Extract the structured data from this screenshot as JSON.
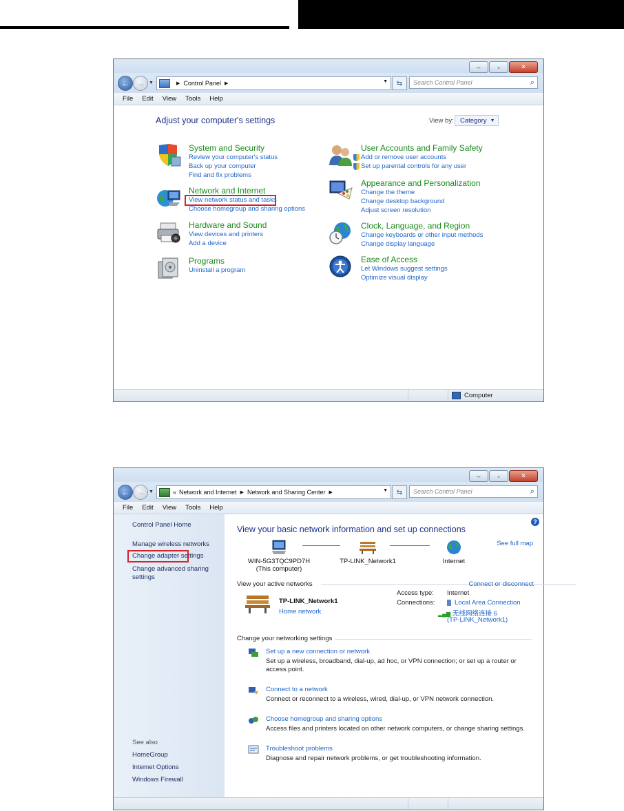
{
  "window1": {
    "breadcrumb": [
      "Control Panel"
    ],
    "search_placeholder": "Search Control Panel",
    "menu": [
      "File",
      "Edit",
      "View",
      "Tools",
      "Help"
    ],
    "heading": "Adjust your computer's settings",
    "view_by_label": "View by:",
    "view_by_value": "Category",
    "categories": [
      {
        "title": "System and Security",
        "links": [
          "Review your computer's status",
          "Back up your computer",
          "Find and fix problems"
        ]
      },
      {
        "title": "Network and Internet",
        "links": [
          "View network status and tasks",
          "Choose homegroup and sharing options"
        ]
      },
      {
        "title": "Hardware and Sound",
        "links": [
          "View devices and printers",
          "Add a device"
        ]
      },
      {
        "title": "Programs",
        "links": [
          "Uninstall a program"
        ]
      },
      {
        "title": "User Accounts and Family Safety",
        "links": [
          "Add or remove user accounts",
          "Set up parental controls for any user"
        ]
      },
      {
        "title": "Appearance and Personalization",
        "links": [
          "Change the theme",
          "Change desktop background",
          "Adjust screen resolution"
        ]
      },
      {
        "title": "Clock, Language, and Region",
        "links": [
          "Change keyboards or other input methods",
          "Change display language"
        ]
      },
      {
        "title": "Ease of Access",
        "links": [
          "Let Windows suggest settings",
          "Optimize visual display"
        ]
      }
    ],
    "status_text": "Computer"
  },
  "window2": {
    "breadcrumb_prefix": "«",
    "breadcrumb": [
      "Network and Internet",
      "Network and Sharing Center"
    ],
    "search_placeholder": "Search Control Panel",
    "menu": [
      "File",
      "Edit",
      "View",
      "Tools",
      "Help"
    ],
    "left_pane": {
      "home": "Control Panel Home",
      "links": [
        "Manage wireless networks",
        "Change adapter settings",
        "Change advanced sharing",
        "settings"
      ],
      "see_also_label": "See also",
      "see_also": [
        "HomeGroup",
        "Internet Options",
        "Windows Firewall"
      ]
    },
    "heading": "View your basic network information and set up connections",
    "see_full_map": "See full map",
    "map": [
      {
        "label": "WIN-5G3TQC9PD7H",
        "sub": "(This computer)"
      },
      {
        "label": "TP-LINK_Network1",
        "sub": ""
      },
      {
        "label": "Internet",
        "sub": ""
      }
    ],
    "active_networks_label": "View your active networks",
    "connect_disconnect": "Connect or disconnect",
    "network_name": "TP-LINK_Network1",
    "network_type": "Home network",
    "access_type_label": "Access type:",
    "access_type_value": "Internet",
    "connections_label": "Connections:",
    "connections": [
      "Local Area Connection",
      "无线网络连接 6",
      "(TP-LINK_Network1)"
    ],
    "change_settings_label": "Change your networking settings",
    "tasks": [
      {
        "link": "Set up a new connection or network",
        "desc": "Set up a wireless, broadband, dial-up, ad hoc, or VPN connection; or set up a router or access point."
      },
      {
        "link": "Connect to a network",
        "desc": "Connect or reconnect to a wireless, wired, dial-up, or VPN network connection."
      },
      {
        "link": "Choose homegroup and sharing options",
        "desc": "Access files and printers located on other network computers, or change sharing settings."
      },
      {
        "link": "Troubleshoot problems",
        "desc": "Diagnose and repair network problems, or get troubleshooting information."
      }
    ]
  }
}
